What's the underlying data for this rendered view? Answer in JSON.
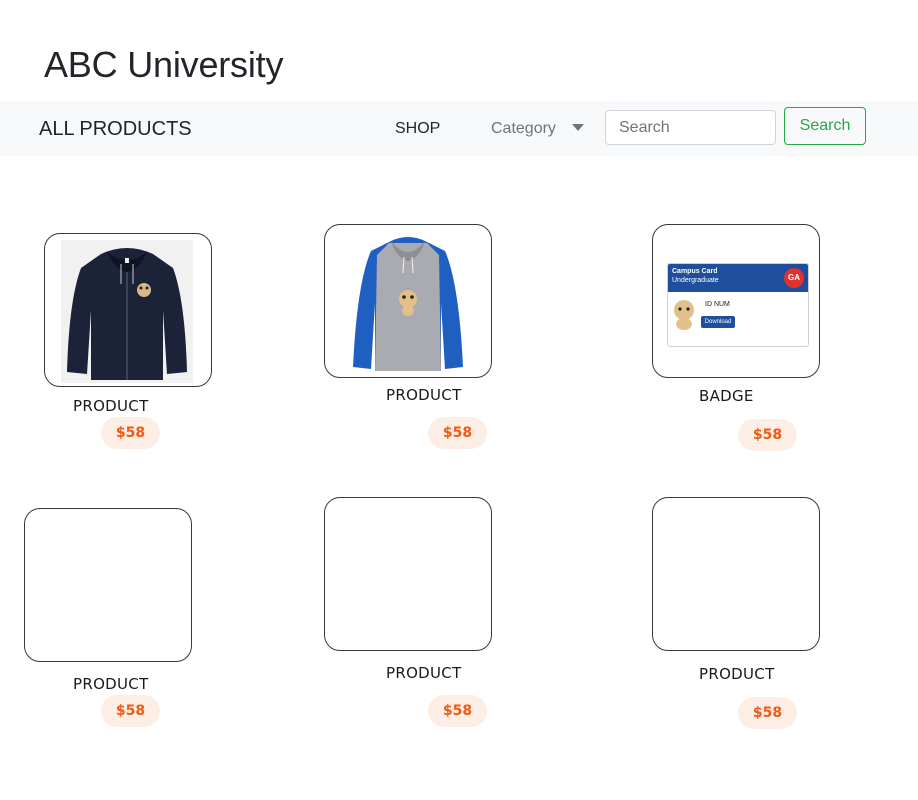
{
  "site": {
    "title": "ABC University"
  },
  "navbar": {
    "brand": "ALL PRODUCTS",
    "shop": "SHOP",
    "category": "Category",
    "search_placeholder": "Search",
    "search_button": "Search"
  },
  "products": [
    {
      "name": "PRODUCT",
      "price": "$58",
      "image": "navy zip hoodie with cat logo"
    },
    {
      "name": "PRODUCT",
      "price": "$58",
      "image": "grey and blue raglan hoodie with cat logo"
    },
    {
      "name": "BADGE",
      "price": "$58",
      "image": "campus card badge",
      "badge": {
        "line1": "Campus Card",
        "line2": "Undergraduate",
        "logo": "GA",
        "id_label": "ID NUM",
        "button": "Download"
      }
    },
    {
      "name": "PRODUCT",
      "price": "$58"
    },
    {
      "name": "PRODUCT",
      "price": "$58"
    },
    {
      "name": "PRODUCT",
      "price": "$58"
    }
  ],
  "colors": {
    "price_text": "#f05a14",
    "price_bg": "#fdeee5",
    "search_button": "#28a745",
    "navbar_bg": "#f8f9fa",
    "badge_header": "#1f4e9c",
    "badge_logo": "#e03131"
  }
}
